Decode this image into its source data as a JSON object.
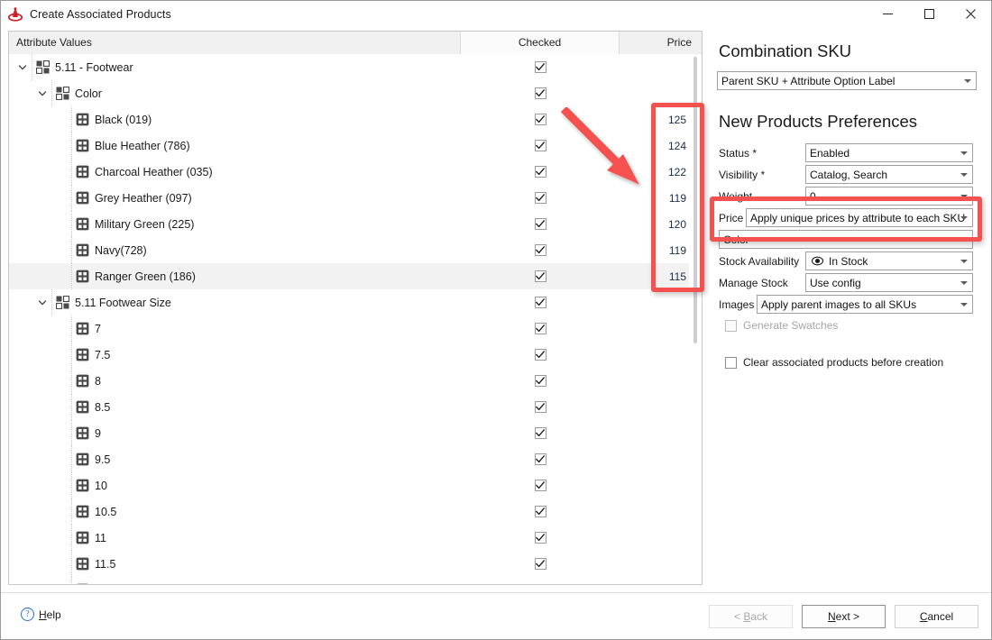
{
  "window": {
    "title": "Create Associated Products",
    "icon": "magento-logo-icon",
    "minimize_label": "Minimize",
    "maximize_label": "Maximize",
    "close_label": "Close"
  },
  "grid": {
    "headers": {
      "attribute": "Attribute Values",
      "checked": "Checked",
      "price": "Price"
    },
    "rows": [
      {
        "label": "5.11 - Footwear",
        "indent": 0,
        "type": "group",
        "expanded": true,
        "checked": true,
        "price": "",
        "selected": false
      },
      {
        "label": "Color",
        "indent": 1,
        "type": "group",
        "expanded": true,
        "checked": true,
        "price": "",
        "selected": false
      },
      {
        "label": "Black (019)",
        "indent": 2,
        "type": "leaf",
        "checked": true,
        "price": "125",
        "selected": false
      },
      {
        "label": "Blue Heather (786)",
        "indent": 2,
        "type": "leaf",
        "checked": true,
        "price": "124",
        "selected": false
      },
      {
        "label": "Charcoal Heather (035)",
        "indent": 2,
        "type": "leaf",
        "checked": true,
        "price": "122",
        "selected": false
      },
      {
        "label": "Grey Heather (097)",
        "indent": 2,
        "type": "leaf",
        "checked": true,
        "price": "119",
        "selected": false
      },
      {
        "label": "Military Green (225)",
        "indent": 2,
        "type": "leaf",
        "checked": true,
        "price": "120",
        "selected": false
      },
      {
        "label": "Navy(728)",
        "indent": 2,
        "type": "leaf",
        "checked": true,
        "price": "119",
        "selected": false
      },
      {
        "label": "Ranger Green (186)",
        "indent": 2,
        "type": "leaf",
        "checked": true,
        "price": "115",
        "selected": true
      },
      {
        "label": "5.11 Footwear Size",
        "indent": 1,
        "type": "group",
        "expanded": true,
        "checked": true,
        "price": "",
        "selected": false
      },
      {
        "label": "7",
        "indent": 2,
        "type": "leaf",
        "checked": true,
        "price": "",
        "selected": false
      },
      {
        "label": "7.5",
        "indent": 2,
        "type": "leaf",
        "checked": true,
        "price": "",
        "selected": false
      },
      {
        "label": "8",
        "indent": 2,
        "type": "leaf",
        "checked": true,
        "price": "",
        "selected": false
      },
      {
        "label": "8.5",
        "indent": 2,
        "type": "leaf",
        "checked": true,
        "price": "",
        "selected": false
      },
      {
        "label": "9",
        "indent": 2,
        "type": "leaf",
        "checked": true,
        "price": "",
        "selected": false
      },
      {
        "label": "9.5",
        "indent": 2,
        "type": "leaf",
        "checked": true,
        "price": "",
        "selected": false
      },
      {
        "label": "10",
        "indent": 2,
        "type": "leaf",
        "checked": true,
        "price": "",
        "selected": false
      },
      {
        "label": "10.5",
        "indent": 2,
        "type": "leaf",
        "checked": true,
        "price": "",
        "selected": false
      },
      {
        "label": "11",
        "indent": 2,
        "type": "leaf",
        "checked": true,
        "price": "",
        "selected": false
      },
      {
        "label": "11.5",
        "indent": 2,
        "type": "leaf",
        "checked": true,
        "price": "",
        "selected": false
      },
      {
        "label": "",
        "indent": 2,
        "type": "leaf",
        "checked": true,
        "price": "",
        "selected": false
      }
    ]
  },
  "right_panel": {
    "combination_sku": {
      "heading": "Combination SKU",
      "value": "Parent SKU + Attribute Option Label"
    },
    "new_products": {
      "heading": "New Products Preferences",
      "fields": {
        "status_label": "Status *",
        "status_value": "Enabled",
        "visibility_label": "Visibility *",
        "visibility_value": "Catalog, Search",
        "weight_label": "Weight",
        "weight_value": "0",
        "price_label": "Price",
        "price_value": "Apply unique prices by attribute to each SKU",
        "price_attribute_value": "Color",
        "stock_availability_label": "Stock Availability",
        "stock_availability_value": "In Stock",
        "manage_stock_label": "Manage Stock",
        "manage_stock_value": "Use config",
        "images_label": "Images",
        "images_value": "Apply parent images to all SKUs"
      },
      "generate_swatches": {
        "label": "Generate Swatches",
        "checked": false,
        "enabled": false
      },
      "clear_associated": {
        "label": "Clear associated products before creation",
        "checked": false,
        "enabled": true
      }
    }
  },
  "footer": {
    "help_label": "Help",
    "help_mnemonic": "H",
    "back_label": "< Back",
    "back_mnemonic": "B",
    "next_label": "Next >",
    "next_mnemonic": "N",
    "cancel_label": "Cancel",
    "cancel_mnemonic": "C"
  },
  "annotations": {
    "accent_color": "#f4514f",
    "price_column_highlight": "price column values",
    "price_field_highlight": "Price / Color dropdowns",
    "arrow": "points to price column"
  },
  "colors": {
    "accent": "#f4514f",
    "header_bg": "#f0f0f0",
    "selection": "#f2f2f2",
    "link": "#1f6fcc"
  }
}
